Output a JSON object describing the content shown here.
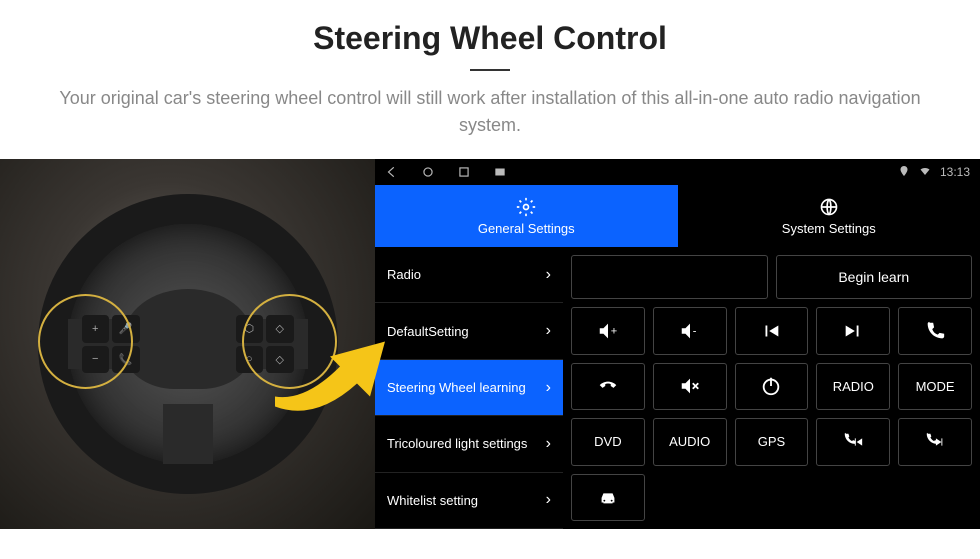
{
  "header": {
    "title": "Steering Wheel Control",
    "subtitle": "Your original car's steering wheel control will still work after installation of this all-in-one auto radio navigation system."
  },
  "status": {
    "time": "13:13"
  },
  "tabs": {
    "general": "General Settings",
    "system": "System Settings"
  },
  "sidebar": {
    "items": [
      {
        "label": "Radio"
      },
      {
        "label": "DefaultSetting"
      },
      {
        "label": "Steering Wheel learning"
      },
      {
        "label": "Tricoloured light settings"
      },
      {
        "label": "Whitelist setting"
      }
    ]
  },
  "panel": {
    "begin": "Begin learn",
    "buttons": {
      "radio": "RADIO",
      "mode": "MODE",
      "dvd": "DVD",
      "audio": "AUDIO",
      "gps": "GPS"
    }
  }
}
